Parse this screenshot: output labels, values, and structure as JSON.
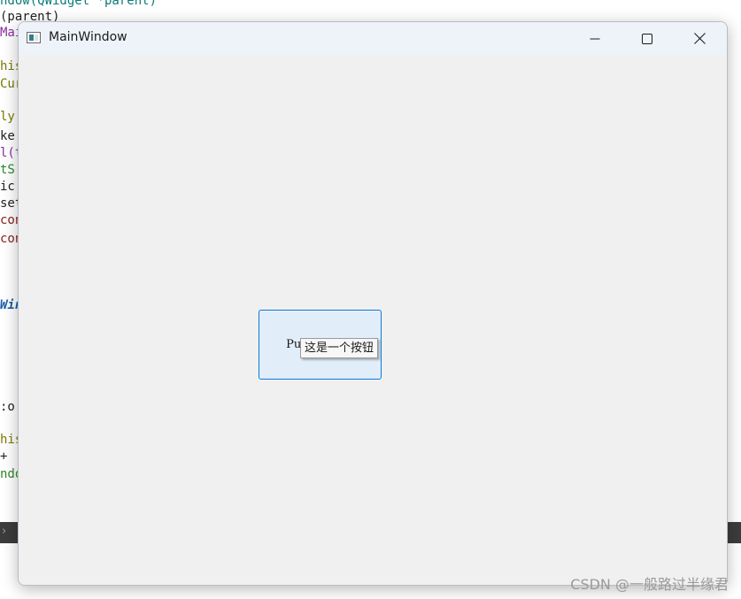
{
  "background_code": {
    "lines": [
      {
        "text": "ndow(QWidget *parent)",
        "color": "teal"
      },
      {
        "text": "(parent)",
        "color": "dark"
      },
      {
        "text": "Mai",
        "color": "purple"
      },
      {
        "text": "his",
        "color": "olive"
      },
      {
        "text": "Cur",
        "color": "olive"
      },
      {
        "text": "ly",
        "color": "olive"
      },
      {
        "text": "ke",
        "color": "dark"
      },
      {
        "text": "l(t",
        "color": "purple"
      },
      {
        "text": "tS",
        "color": "green"
      },
      {
        "text": "ic",
        "color": "dark"
      },
      {
        "text": "set",
        "color": "dark"
      },
      {
        "text": "con",
        "color": "red"
      },
      {
        "text": "con",
        "color": "red"
      },
      {
        "text": "Win",
        "color": "blue"
      },
      {
        "text": ":o",
        "color": "dark"
      },
      {
        "text": "his",
        "color": "olive"
      },
      {
        "text": "+",
        "color": "dark"
      },
      {
        "text": "ndo",
        "color": "green"
      }
    ]
  },
  "ide_statusbar": {
    "chevron": "›"
  },
  "window": {
    "title": "MainWindow",
    "icon": "qt-window-icon",
    "controls": {
      "minimize": "minimize-icon",
      "maximize": "maximize-icon",
      "close": "close-icon"
    }
  },
  "content": {
    "push_button_label": "PushButton",
    "tooltip_text": "这是一个按钮"
  },
  "watermark": "CSDN @一般路过半缘君",
  "colors": {
    "titlebar_bg": "#eef3fa",
    "client_bg": "#f0f0f0",
    "button_bg": "#e1eefa",
    "button_border": "#0f78d4",
    "ide_statusbar": "#3c3c3c"
  }
}
